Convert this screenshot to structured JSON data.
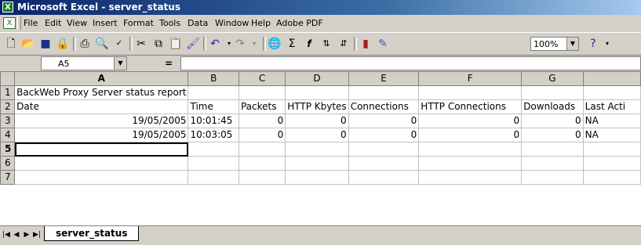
{
  "window": {
    "title": "Microsoft Excel - server_status"
  },
  "menu": [
    "File",
    "Edit",
    "View",
    "Insert",
    "Format",
    "Tools",
    "Data",
    "Window",
    "Help",
    "Adobe PDF"
  ],
  "toolbar": {
    "zoom": "100%"
  },
  "formula_bar": {
    "cell_ref": "A5",
    "equals": "="
  },
  "sheet": {
    "columns": [
      "A",
      "B",
      "C",
      "D",
      "E",
      "F",
      "G",
      ""
    ],
    "rows": [
      {
        "n": "1",
        "cells": [
          "BackWeb Proxy Server status report",
          "",
          "",
          "",
          "",
          "",
          "",
          ""
        ]
      },
      {
        "n": "2",
        "cells": [
          "Date",
          "Time",
          "Packets",
          "HTTP Kbytes",
          "Connections",
          "HTTP Connections",
          "Downloads",
          "Last Acti"
        ]
      },
      {
        "n": "3",
        "cells": [
          "19/05/2005",
          "10:01:45",
          "0",
          "0",
          "0",
          "0",
          "0",
          "NA"
        ]
      },
      {
        "n": "4",
        "cells": [
          "19/05/2005",
          "10:03:05",
          "0",
          "0",
          "0",
          "0",
          "0",
          "NA"
        ]
      },
      {
        "n": "5",
        "cells": [
          "",
          "",
          "",
          "",
          "",
          "",
          "",
          ""
        ]
      },
      {
        "n": "6",
        "cells": [
          "",
          "",
          "",
          "",
          "",
          "",
          "",
          ""
        ]
      },
      {
        "n": "7",
        "cells": [
          "",
          "",
          "",
          "",
          "",
          "",
          "",
          ""
        ]
      }
    ]
  },
  "tabs": {
    "active": "server_status"
  },
  "icons": [
    "excel-app-icon",
    "new-icon",
    "open-icon",
    "save-icon",
    "permission-icon",
    "print-icon",
    "print-preview-icon",
    "spelling-icon",
    "cut-icon",
    "copy-icon",
    "paste-icon",
    "format-painter-icon",
    "undo-icon",
    "redo-icon",
    "hyperlink-icon",
    "autosum-icon",
    "function-icon",
    "sort-asc-icon",
    "sort-desc-icon",
    "chart-icon",
    "drawing-icon",
    "help-icon"
  ]
}
